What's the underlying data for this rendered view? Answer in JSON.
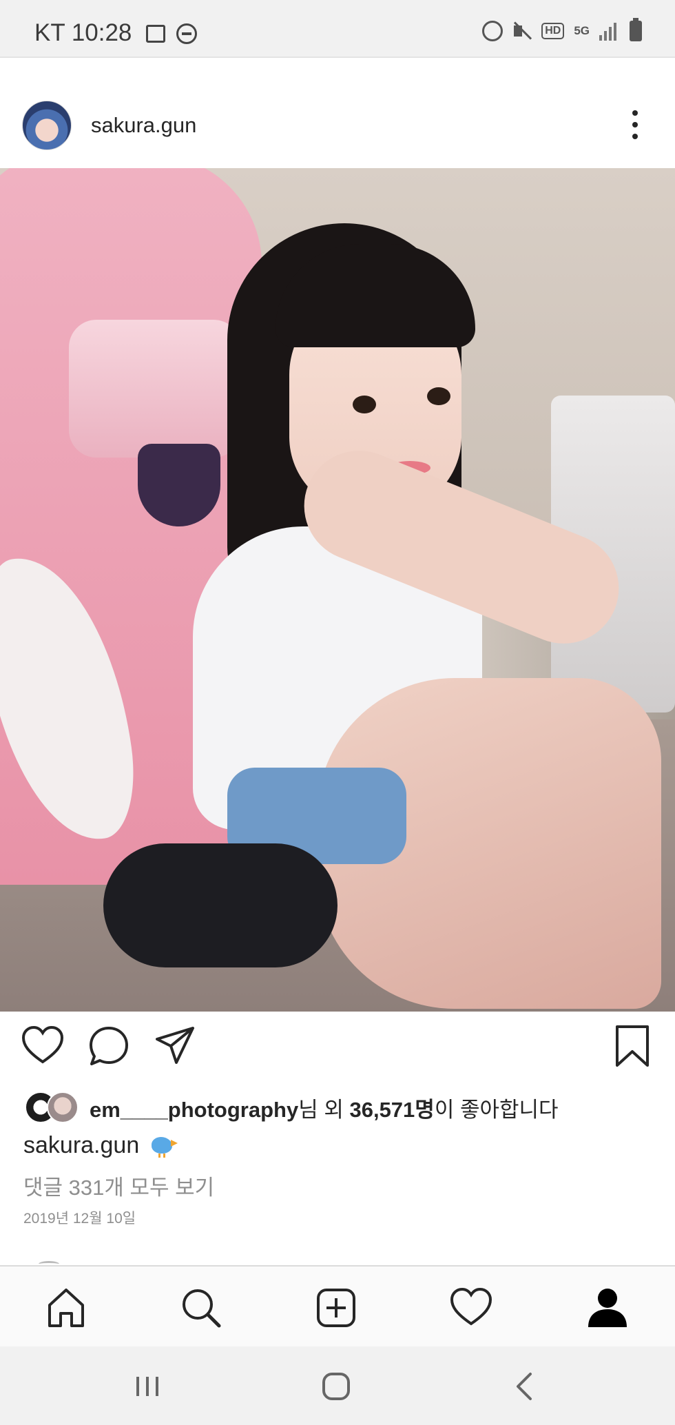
{
  "status_bar": {
    "time": "KT 10:28",
    "network_badge": "5G",
    "hd_badge": "HD",
    "icons": [
      "gallery-icon",
      "dnd-icon",
      "alarm-icon",
      "mute-icon",
      "hd-voice-icon",
      "5g-icon",
      "signal-icon",
      "battery-icon"
    ]
  },
  "post": {
    "username": "sakura.gun",
    "photo_alt": "photo",
    "actions": {
      "icons": [
        "heart-icon",
        "comment-icon",
        "send-icon",
        "bookmark-icon"
      ]
    },
    "likes": {
      "first_liker": "em____photography",
      "connector": "님 외 ",
      "count": "36,571명",
      "suffix": "이 좋아합니다"
    },
    "caption": {
      "username": "sakura.gun",
      "emoji_icon": "bird-icon"
    },
    "view_comments": "댓글 331개 모두 보기",
    "date": "2019년 12월 10일"
  },
  "bottom_nav": {
    "items": [
      "home-icon",
      "search-icon",
      "add-post-icon",
      "activity-heart-icon",
      "profile-icon"
    ]
  },
  "system_nav": {
    "items": [
      "recents-icon",
      "home-button-icon",
      "back-icon"
    ]
  },
  "colors": {
    "text": "#262626",
    "secondary_text": "#8e8e8e",
    "nav_background": "#fafafa",
    "status_background": "#f1f1f1"
  }
}
